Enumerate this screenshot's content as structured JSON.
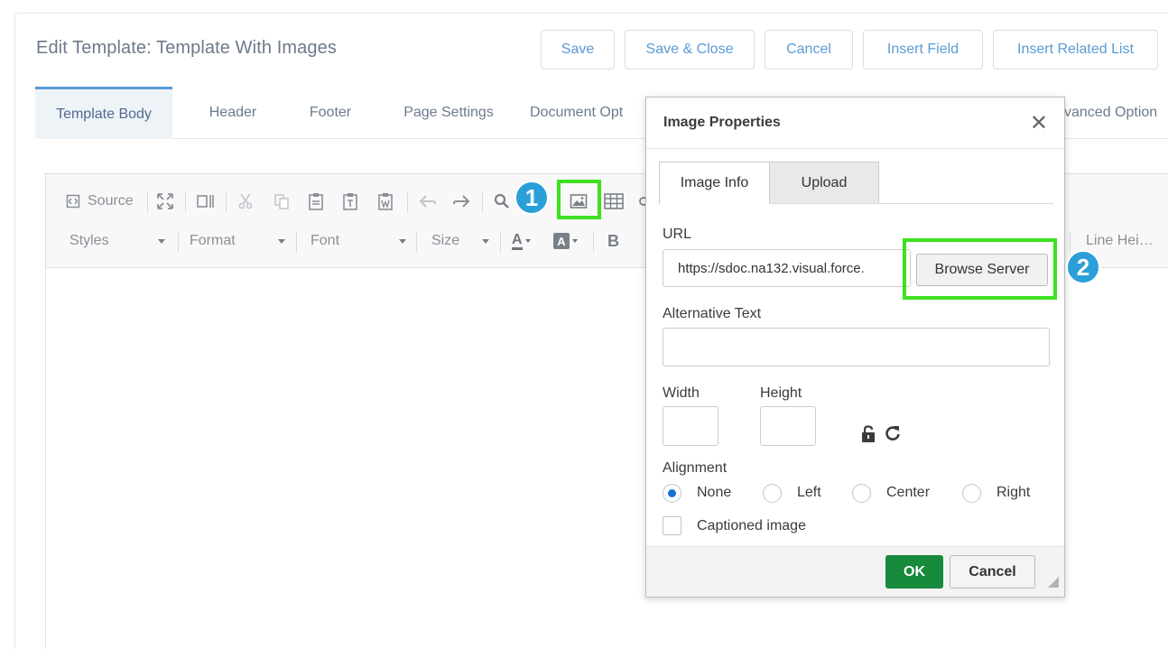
{
  "page": {
    "title": "Edit Template: Template With Images",
    "buttons": {
      "save": "Save",
      "save_close": "Save & Close",
      "cancel": "Cancel",
      "insert_field": "Insert Field",
      "insert_related_list": "Insert Related List"
    },
    "tabs": [
      "Template Body",
      "Header",
      "Footer",
      "Page Settings",
      "Document Opt",
      "vanced Option"
    ]
  },
  "toolbar": {
    "source_label": "Source",
    "styles_label": "Styles",
    "format_label": "Format",
    "font_label": "Font",
    "size_label": "Size",
    "line_height_label": "Line Hei…",
    "bold_label": "B",
    "text_color_label": "A",
    "bg_color_label": "A"
  },
  "callouts": {
    "one": "1",
    "two": "2"
  },
  "colors": {
    "highlight": "#3ee01f",
    "callout": "#2a9fd8",
    "ok_button": "#178a3c",
    "link_blue": "#5b9bd5"
  },
  "dialog": {
    "title": "Image Properties",
    "close_glyph": "✕",
    "tabs": {
      "image_info": "Image Info",
      "upload": "Upload"
    },
    "url_label": "URL",
    "url_value": "https://sdoc.na132.visual.force.",
    "browse_button": "Browse Server",
    "alt_text_label": "Alternative Text",
    "alt_text_value": "",
    "width_label": "Width",
    "width_value": "",
    "height_label": "Height",
    "height_value": "",
    "alignment_label": "Alignment",
    "alignment_options": [
      "None",
      "Left",
      "Center",
      "Right"
    ],
    "alignment_selected": "None",
    "captioned_label": "Captioned image",
    "captioned_checked": false,
    "ok_button": "OK",
    "cancel_button": "Cancel"
  }
}
